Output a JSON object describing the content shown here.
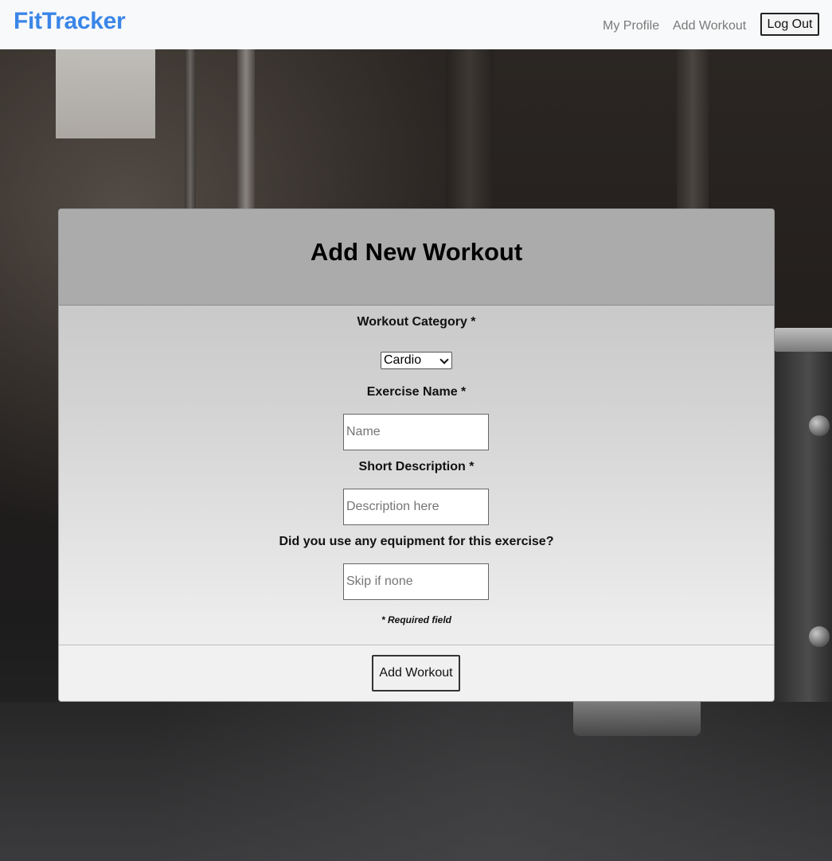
{
  "navbar": {
    "brand": "FitTracker",
    "links": [
      {
        "label": "My Profile"
      },
      {
        "label": "Add Workout"
      }
    ],
    "logout_label": "Log Out"
  },
  "form": {
    "title": "Add New Workout",
    "category": {
      "label": "Workout Category *",
      "selected": "Cardio"
    },
    "exercise_name": {
      "label": "Exercise Name *",
      "placeholder": "Name"
    },
    "description": {
      "label": "Short Description *",
      "placeholder": "Description here"
    },
    "equipment": {
      "label": "Did you use any equipment for this exercise?",
      "placeholder": "Skip if none"
    },
    "required_note": "* Required field",
    "submit_label": "Add Workout"
  },
  "colors": {
    "brand": "#3a86e8",
    "navbar_bg": "#f8f9fa",
    "card_header_bg": "#ababab"
  }
}
